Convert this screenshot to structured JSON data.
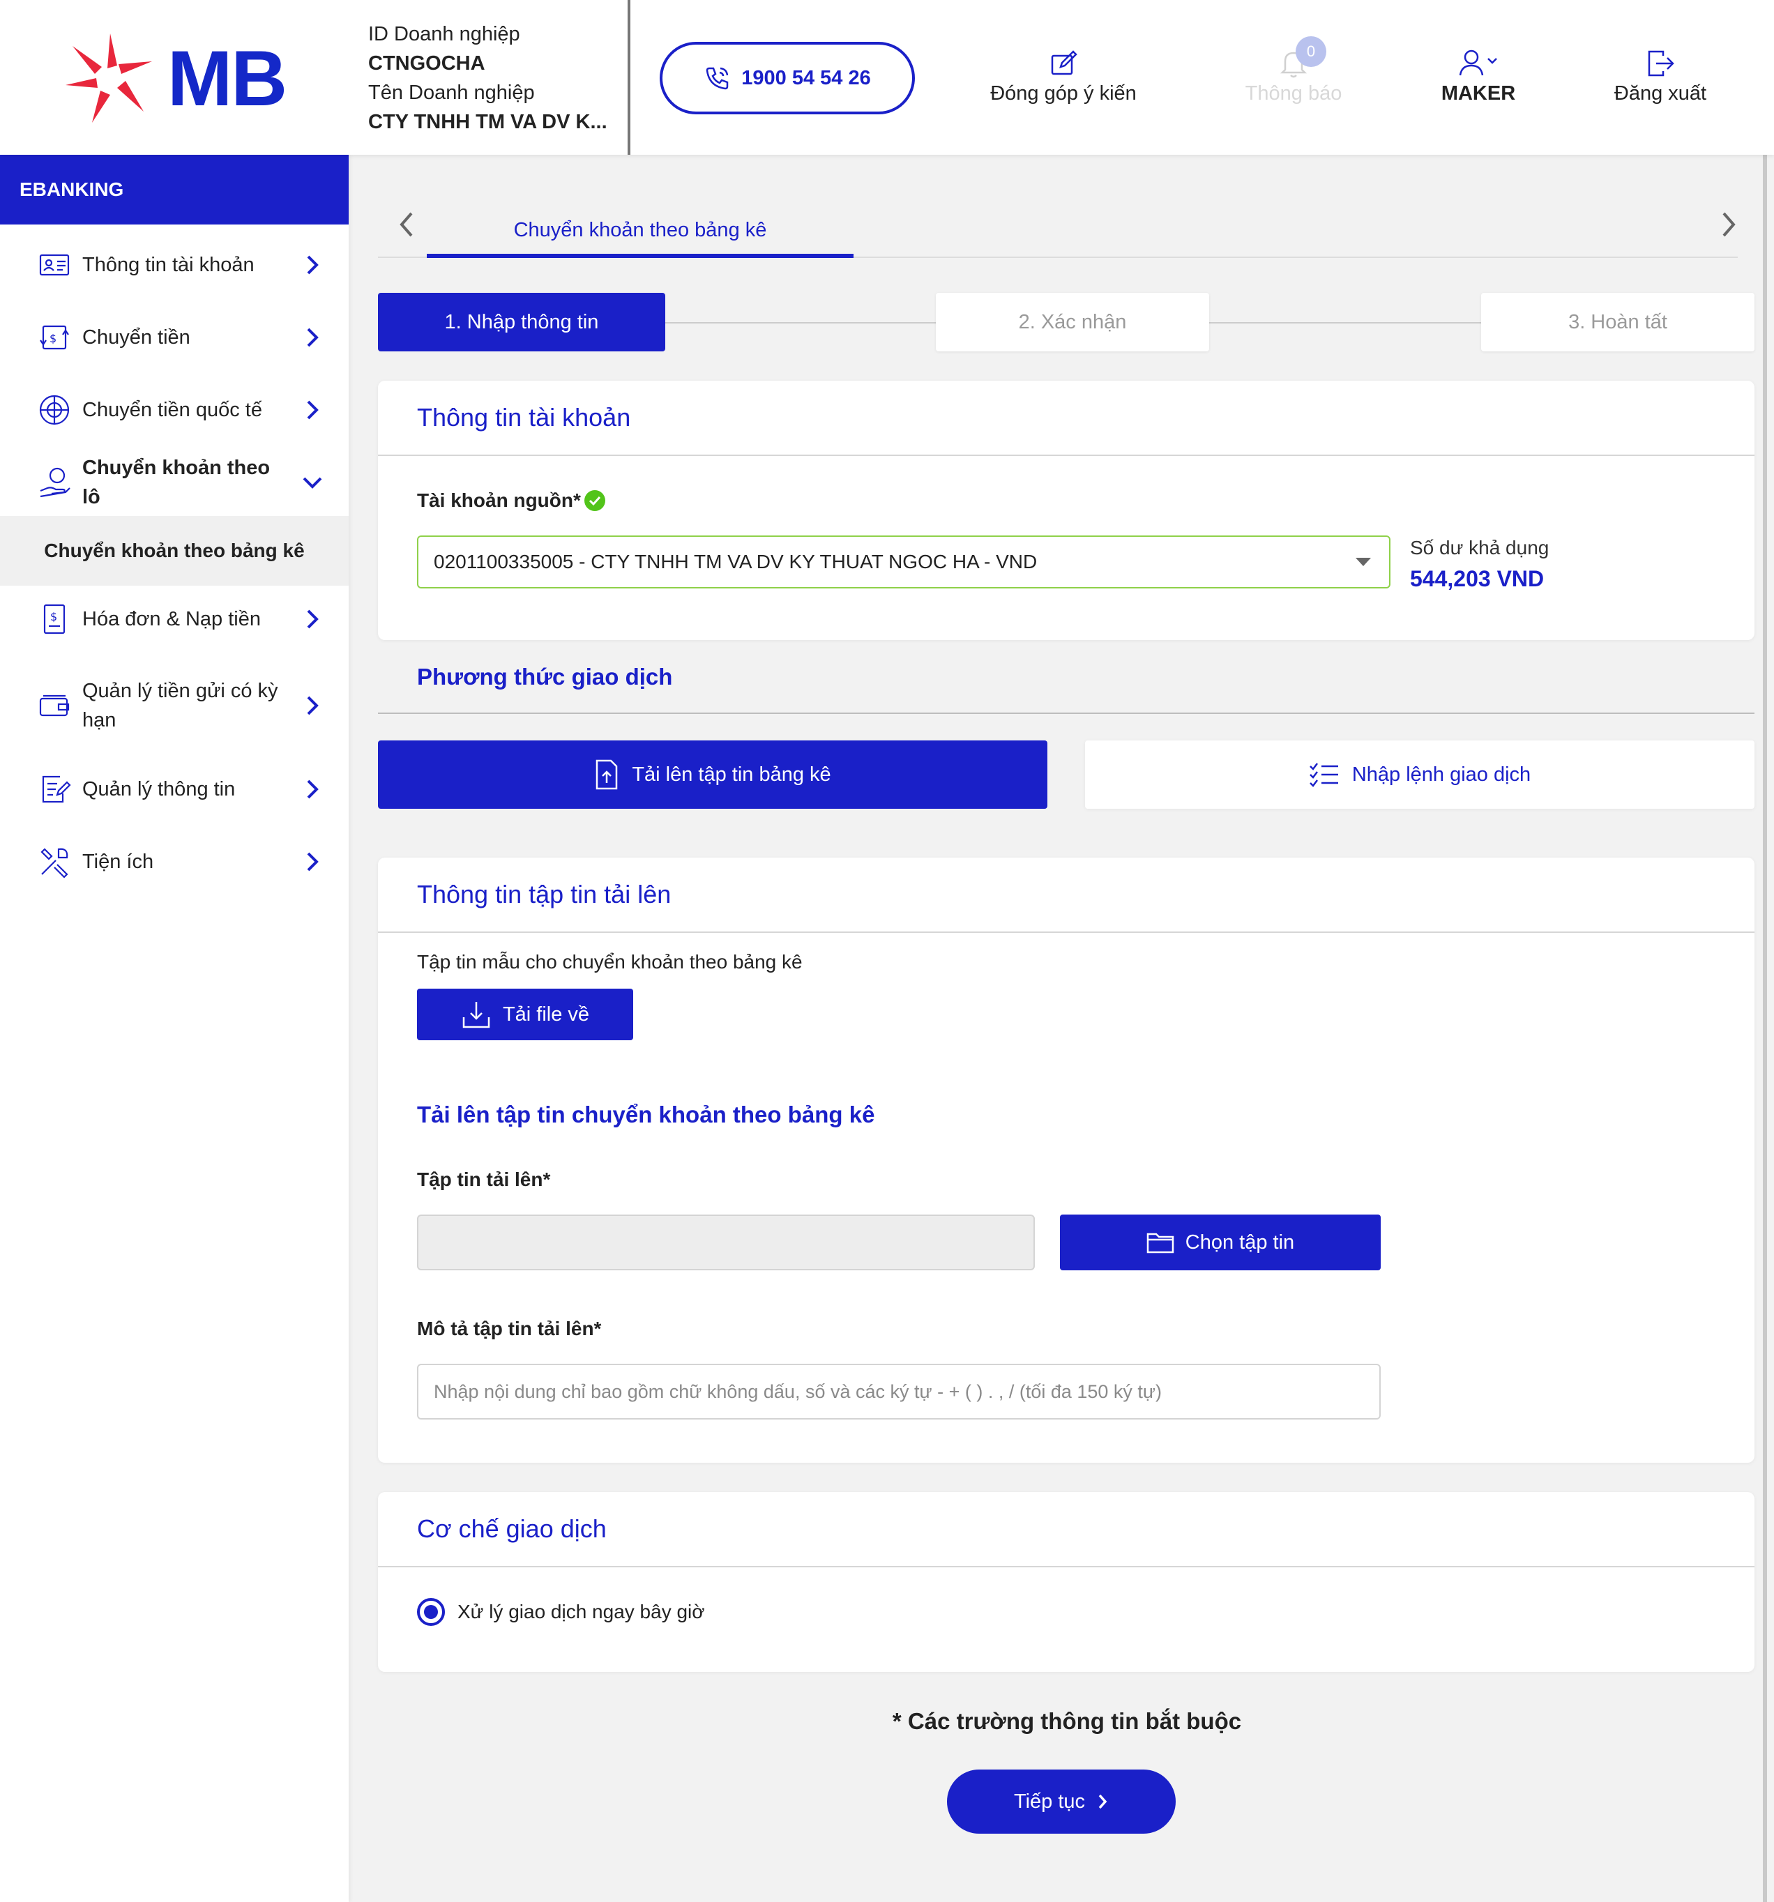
{
  "brand": {
    "logo_text": "MB",
    "primary_color": "#1a20c8",
    "logo_star_color": "#e8273c",
    "success_color": "#52c41a"
  },
  "header": {
    "company_id_label": "ID Doanh nghiệp",
    "company_id": "CTNGOCHA",
    "company_name_label": "Tên Doanh nghiệp",
    "company_name": "CTY TNHH TM VA DV K...",
    "hotline": "1900 54 54 26",
    "feedback_label": "Đóng góp ý kiến",
    "notification_label": "Thông báo",
    "notification_count": "0",
    "user_role": "MAKER",
    "logout_label": "Đăng xuất"
  },
  "sidebar": {
    "title": "EBANKING",
    "items": [
      {
        "label": "Thông tin tài khoản",
        "icon": "account-card-icon"
      },
      {
        "label": "Chuyển tiền",
        "icon": "transfer-icon"
      },
      {
        "label": "Chuyển tiền quốc tế",
        "icon": "globe-money-icon"
      },
      {
        "label": "Chuyển khoản theo lô",
        "icon": "hand-coin-icon"
      },
      {
        "label": "Hóa đơn & Nạp tiền",
        "icon": "bill-icon"
      },
      {
        "label": "Quản lý tiền gửi có kỳ hạn",
        "icon": "wallet-icon"
      },
      {
        "label": "Quản lý thông tin",
        "icon": "document-edit-icon"
      },
      {
        "label": "Tiện ích",
        "icon": "tools-icon"
      }
    ],
    "active_sub": "Chuyển khoản theo bảng kê"
  },
  "tabs": {
    "active": "Chuyển khoản theo bảng kê"
  },
  "steps": [
    {
      "label": "1.  Nhập thông tin",
      "state": "active"
    },
    {
      "label": "2.  Xác nhận",
      "state": "idle"
    },
    {
      "label": "3.  Hoàn tất",
      "state": "idle"
    }
  ],
  "account_section": {
    "title": "Thông tin tài khoản",
    "source_label": "Tài khoản nguồn*",
    "source_value": "0201100335005 - CTY TNHH TM VA DV KY THUAT NGOC HA - VND",
    "balance_label": "Số dư khả dụng",
    "balance_value": "544,203 VND"
  },
  "method_section": {
    "title": "Phương thức giao dịch",
    "upload_label": "Tải lên tập tin bảng kê",
    "manual_label": "Nhập lệnh giao dịch"
  },
  "upload_section": {
    "title": "Thông tin tập tin tải lên",
    "template_label": "Tập tin mẫu cho chuyển khoản theo bảng kê",
    "download_label": "Tải file về",
    "upload_heading": "Tải lên tập tin chuyển khoản theo bảng kê",
    "file_label": "Tập tin tải lên*",
    "file_value": "",
    "choose_label": "Chọn tập tin",
    "desc_label": "Mô tả tập tin tải lên*",
    "desc_value": "",
    "desc_placeholder": "Nhập nội dung chỉ bao gồm chữ không dấu, số và các ký tự - + ( ) . , / (tối đa 150 ký tự)"
  },
  "mechanism_section": {
    "title": "Cơ chế giao dịch",
    "option_label": "Xử lý giao dịch ngay bây giờ",
    "option_selected": true
  },
  "footer": {
    "required_note": "* Các trường thông tin bắt buộc",
    "continue_label": "Tiếp tục"
  }
}
